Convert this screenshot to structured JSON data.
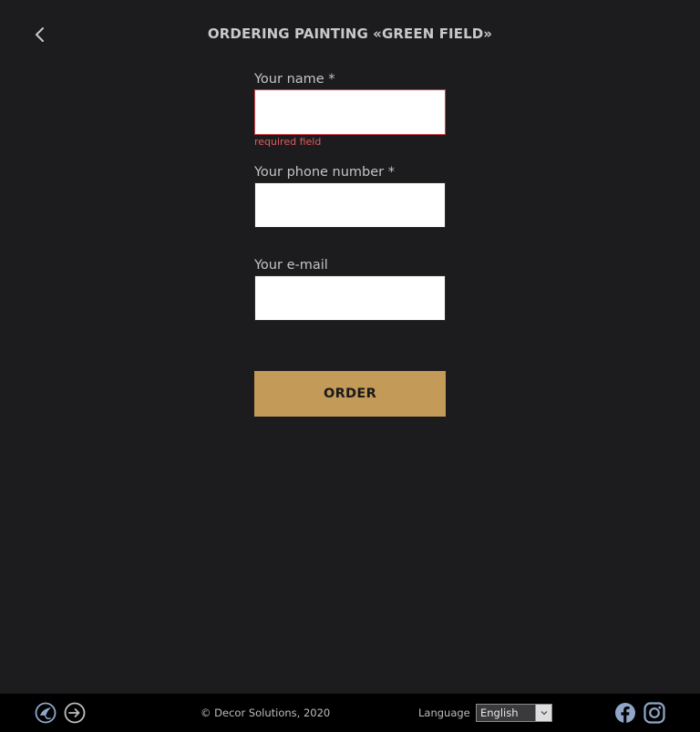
{
  "header": {
    "back_icon": "chevron-left-icon",
    "title": "ORDERING PAINTING «GREEN FIELD»"
  },
  "form": {
    "name": {
      "label": "Your name *",
      "value": "",
      "error": "required field"
    },
    "phone": {
      "label": "Your phone number *",
      "value": ""
    },
    "email": {
      "label": "Your e-mail",
      "value": ""
    },
    "submit_label": "ORDER"
  },
  "footer": {
    "left_icons": [
      "brush-logo-icon",
      "login-icon"
    ],
    "copyright": "© Decor Solutions, 2020",
    "language_label": "Language",
    "language_value": "English",
    "social_icons": [
      "facebook-icon",
      "instagram-icon"
    ]
  },
  "colors": {
    "background": "#1c1c1e",
    "footer_background": "#000000",
    "accent": "#c49a58",
    "error": "#e05a5e",
    "text": "#c4c4c4",
    "icon": "#8fa6c8"
  }
}
